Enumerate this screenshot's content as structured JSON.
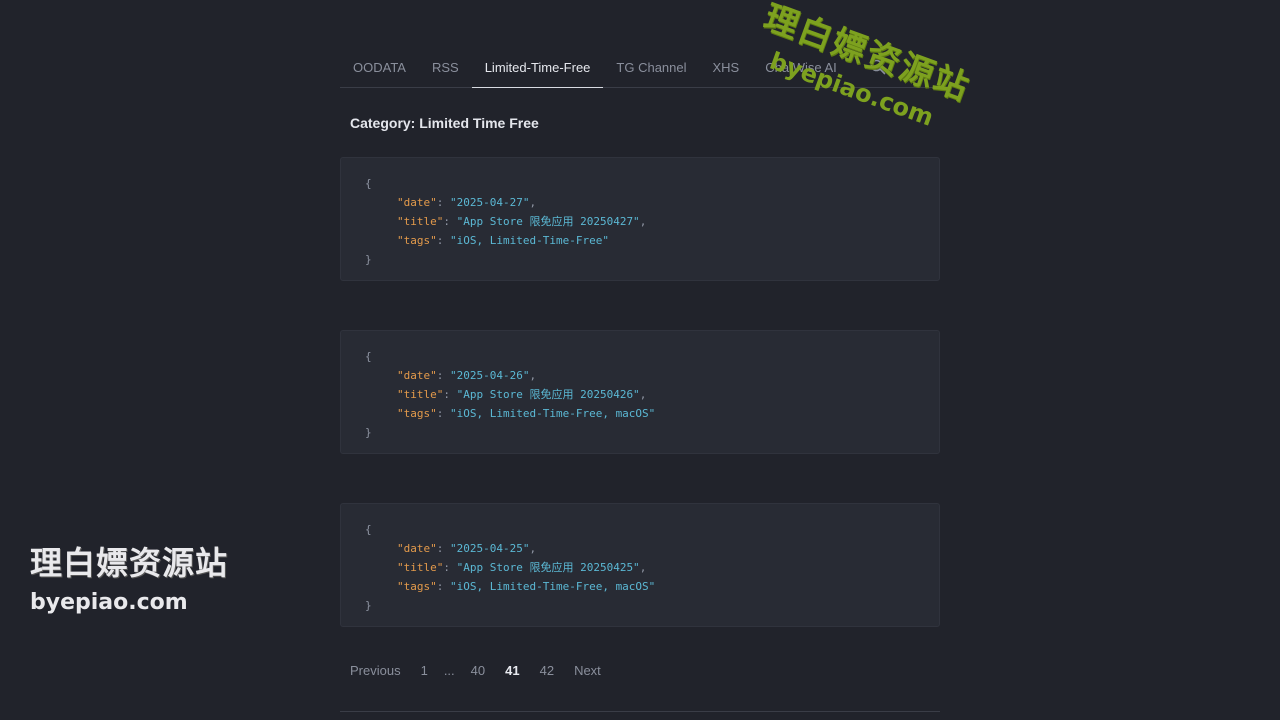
{
  "nav": {
    "tabs": [
      {
        "label": "OODATA",
        "active": false
      },
      {
        "label": "RSS",
        "active": false
      },
      {
        "label": "Limited-Time-Free",
        "active": true
      },
      {
        "label": "TG Channel",
        "active": false
      },
      {
        "label": "XHS",
        "active": false
      },
      {
        "label": "ChatWise AI",
        "active": false
      }
    ],
    "search_icon": "search-icon"
  },
  "category_title": "Category: Limited Time Free",
  "entries": [
    {
      "open": "{",
      "date_key": "\"date\"",
      "date": "\"2025-04-27\"",
      "title_key": "\"title\"",
      "title": "\"App Store 限免应用 20250427\"",
      "tags_key": "\"tags\"",
      "tags": "\"iOS, Limited-Time-Free\"",
      "close": "}"
    },
    {
      "open": "{",
      "date_key": "\"date\"",
      "date": "\"2025-04-26\"",
      "title_key": "\"title\"",
      "title": "\"App Store 限免应用 20250426\"",
      "tags_key": "\"tags\"",
      "tags": "\"iOS, Limited-Time-Free, macOS\"",
      "close": "}"
    },
    {
      "open": "{",
      "date_key": "\"date\"",
      "date": "\"2025-04-25\"",
      "title_key": "\"title\"",
      "title": "\"App Store 限免应用 20250425\"",
      "tags_key": "\"tags\"",
      "tags": "\"iOS, Limited-Time-Free, macOS\"",
      "close": "}"
    }
  ],
  "pagination": {
    "previous": "Previous",
    "first": "1",
    "ellipsis": "...",
    "prev_page": "40",
    "current": "41",
    "next_page": "42",
    "next": "Next"
  },
  "watermark": {
    "cn": "理白嫖资源站",
    "en": "byepiao.com"
  },
  "colors": {
    "background": "#21232b",
    "card": "#282b34",
    "json_key": "#e39a4b",
    "json_string": "#5bb8d4",
    "watermark_green": "#7da11f"
  }
}
